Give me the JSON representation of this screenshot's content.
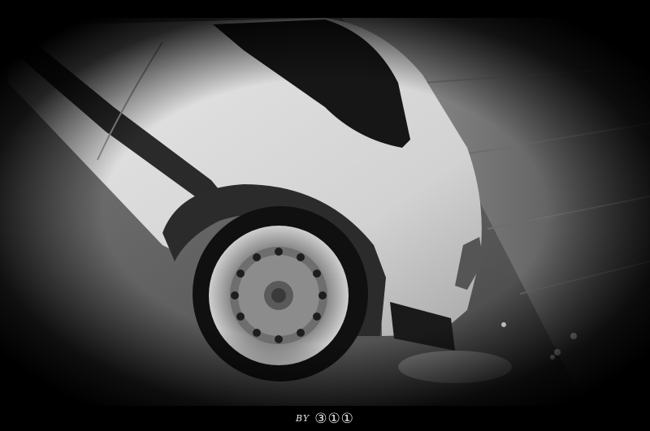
{
  "photo": {
    "subject": "white-hatchback-rear-wheel",
    "style": "black-and-white-vignette"
  },
  "credit": {
    "prefix": "BY",
    "text": "③①①"
  }
}
